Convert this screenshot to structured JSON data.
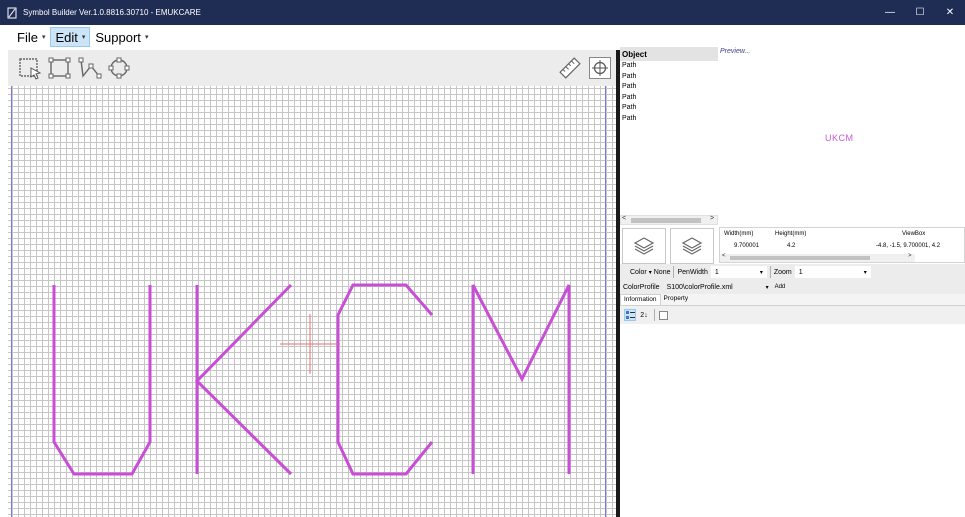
{
  "window": {
    "title": "Symbol Builder Ver.1.0.8816.30710 - EMUKCARE",
    "minimize_icon": "minimize-icon",
    "maximize_icon": "maximize-icon",
    "close_icon": "close-icon",
    "minimize_glyph": "—",
    "maximize_glyph": "☐",
    "close_glyph": "✕"
  },
  "menu": {
    "items": [
      {
        "label": "File",
        "caret": "▾"
      },
      {
        "label": "Edit",
        "caret": "▾"
      },
      {
        "label": "Support",
        "caret": "▾"
      }
    ]
  },
  "toolbar": {
    "tools": [
      "select-tool-icon",
      "rectangle-tool-icon",
      "polyline-tool-icon",
      "circle-tool-icon"
    ],
    "right_tools": [
      "ruler-icon",
      "crosshair-icon"
    ]
  },
  "canvas": {
    "stroke_color": "#c94ed6",
    "crosshair_color": "#e07070",
    "grid_color": "#c6c6c6"
  },
  "object_panel": {
    "header": "Object",
    "rows": [
      "Path",
      "Path",
      "Path",
      "Path",
      "Path",
      "Path"
    ]
  },
  "preview": {
    "label": "Preview...",
    "text": "UKCM",
    "text_color": "#c85ad6"
  },
  "scroll": {
    "left_arrow": "<",
    "right_arrow": ">"
  },
  "dimensions": {
    "width_label": "Width(mm)",
    "height_label": "Height(mm)",
    "viewbox_label": "ViewBox",
    "width_value": "9.700001",
    "height_value": "4.2",
    "viewbox_value": "-4.8, -1.5, 9.700001, 4.2",
    "left_arrow": "<",
    "right_arrow": ">"
  },
  "properties": {
    "color_label": "Color",
    "color_caret": "▾",
    "color_value": "None",
    "penwidth_label": "PenWidth",
    "penwidth_value": "1",
    "penwidth_caret": "▾",
    "zoom_label": "Zoom",
    "zoom_value": "1",
    "zoom_caret": "▾"
  },
  "color_profile": {
    "label": "ColorProfile",
    "value": "S100\\colorProfile.xml",
    "caret": "▾",
    "add_label": "Add"
  },
  "tabs": [
    {
      "label": "Information"
    },
    {
      "label": "Property"
    }
  ],
  "tab_tools": {
    "sort_desc": "2↓"
  }
}
